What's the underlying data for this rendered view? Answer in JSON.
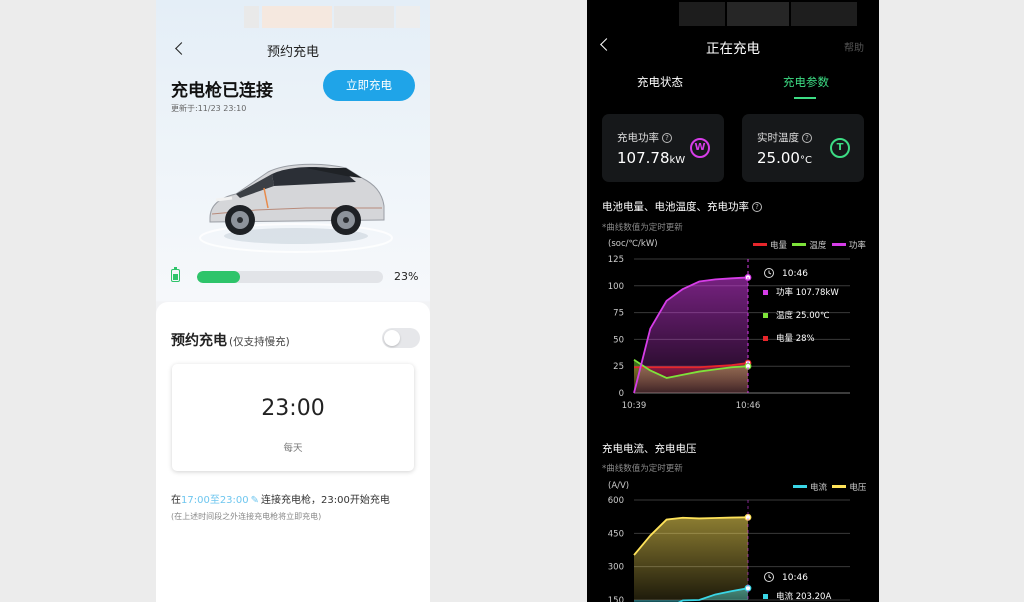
{
  "left": {
    "nav_title": "预约充电",
    "connection_title": "充电枪已连接",
    "update_time": "更新于:11/23 23:10",
    "charge_now_label": "立即充电",
    "battery_percent": "23%",
    "battery_fraction": 0.23,
    "schedule_title": "预约充电",
    "schedule_subtitle": "(仅支持慢充)",
    "schedule_enabled": false,
    "schedule_time": "23:00",
    "schedule_repeat": "每天",
    "rule_prefix": "在",
    "rule_window": "17:00至23:00",
    "rule_suffix": "连接充电枪，23:00开始充电",
    "rule_note": "(在上述时间段之外连接充电枪将立即充电)"
  },
  "right": {
    "nav_title": "正在充电",
    "help_label": "帮助",
    "tabs": [
      {
        "label": "充电状态",
        "active": false
      },
      {
        "label": "充电参数",
        "active": true
      }
    ],
    "metrics": [
      {
        "label": "充电功率",
        "value": "107.78",
        "unit": "kW",
        "icon": "W",
        "icon_color": "#d63de8"
      },
      {
        "label": "实时温度",
        "value": "25.00",
        "unit": "°C",
        "icon": "T",
        "icon_color": "#3ddc84"
      }
    ],
    "chart1_title": "电池电量、电池温度、充电功率",
    "chart1_note": "*曲线数值为定时更新",
    "chart2_title": "充电电流、充电电压",
    "chart2_note": "*曲线数值为定时更新"
  },
  "colors": {
    "accent_blue": "#1fa4e8",
    "battery_green": "#2ec46a",
    "power_purple": "#d63de8",
    "temp_green": "#7ee33a",
    "soc_red": "#e8262b",
    "current_cyan": "#3ad6e6",
    "voltage_yellow": "#ffe35a"
  },
  "chart_data": [
    {
      "type": "line",
      "title": "电池电量、电池温度、充电功率",
      "ylabel": "(soc/℃/kW)",
      "ylim": [
        0,
        125
      ],
      "yticks": [
        "0",
        "25",
        "50",
        "75",
        "100",
        "125"
      ],
      "xticks": [
        "10:39",
        "10:46"
      ],
      "legend": "top-right",
      "grid": true,
      "series": [
        {
          "name": "电量",
          "color": "#e8262b",
          "x": [
            0,
            1,
            2,
            3,
            4,
            5,
            6,
            7
          ],
          "values": [
            24,
            24,
            24,
            24,
            24,
            25,
            26,
            28
          ]
        },
        {
          "name": "温度",
          "color": "#7ee33a",
          "x": [
            0,
            1,
            2,
            3,
            4,
            5,
            6,
            7
          ],
          "values": [
            31,
            21,
            14,
            17,
            20,
            22,
            24,
            25
          ]
        },
        {
          "name": "功率",
          "color": "#d63de8",
          "x": [
            0,
            1,
            2,
            3,
            4,
            5,
            6,
            7
          ],
          "values": [
            0,
            60,
            86,
            97,
            104,
            106,
            107,
            107.78
          ]
        }
      ],
      "tooltip": {
        "time": "10:46",
        "rows": [
          {
            "label": "功率 107.78kW",
            "color": "#d63de8"
          },
          {
            "label": "温度 25.00℃",
            "color": "#7ee33a"
          },
          {
            "label": "电量 28%",
            "color": "#e8262b"
          }
        ]
      }
    },
    {
      "type": "line",
      "title": "充电电流、充电电压",
      "ylabel": "(A/V)",
      "yticks": [
        "600",
        "450",
        "300",
        "150"
      ],
      "ylim": [
        150,
        600
      ],
      "legend": "top-right",
      "grid": true,
      "series": [
        {
          "name": "电流",
          "color": "#3ad6e6",
          "x": [
            0,
            1,
            2,
            3,
            4,
            5,
            6,
            7
          ],
          "values": [
            40,
            70,
            110,
            148,
            150,
            175,
            190,
            203.2
          ]
        },
        {
          "name": "电压",
          "color": "#ffe35a",
          "x": [
            0,
            1,
            2,
            3,
            4,
            5,
            6,
            7
          ],
          "values": [
            352,
            440,
            512,
            520,
            517,
            519,
            521,
            522
          ]
        }
      ],
      "tooltip": {
        "time": "10:46",
        "rows": [
          {
            "label": "电流 203.20A",
            "color": "#3ad6e6"
          }
        ]
      }
    }
  ]
}
